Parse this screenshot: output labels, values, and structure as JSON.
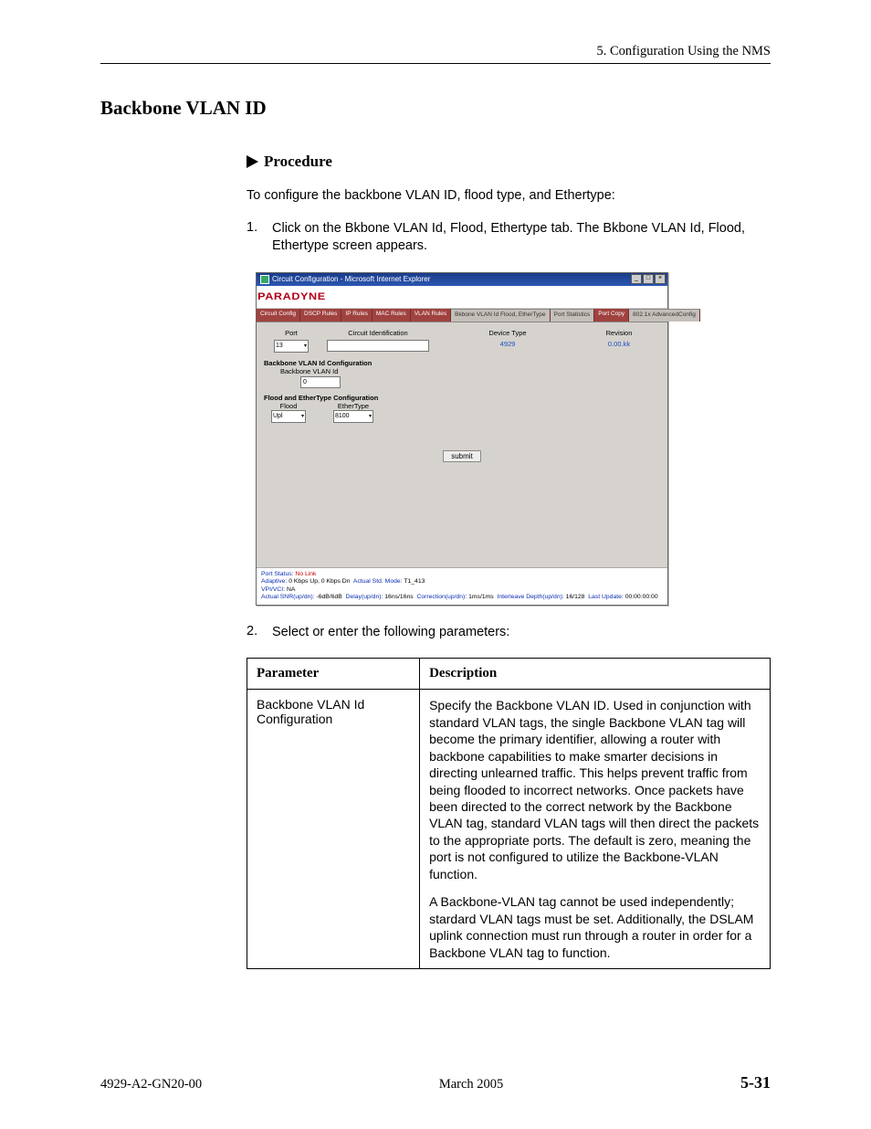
{
  "chapter_header": "5. Configuration Using the NMS",
  "section_title": "Backbone VLAN ID",
  "procedure_label": "Procedure",
  "intro_text": "To configure the backbone VLAN ID, flood type, and Ethertype:",
  "steps": {
    "s1_num": "1.",
    "s1_text": "Click on the Bkbone VLAN Id, Flood, Ethertype tab. The Bkbone VLAN Id, Flood, Ethertype screen appears.",
    "s2_num": "2.",
    "s2_text": "Select or enter the following parameters:"
  },
  "screenshot": {
    "window_title": "Circuit Configuration - Microsoft Internet Explorer",
    "brand": "PARADYNE",
    "tabs": {
      "t0": "Circuit Config",
      "t1": "DSCP Rules",
      "t2": "IP Rules",
      "t3": "MAC Rules",
      "t4": "VLAN Rules",
      "t5": "Bkbone VLAN Id  Flood, EtherType",
      "t6": "Port Statistics",
      "t7": "Port Copy",
      "t8": "802.1x  AdvancedConfig"
    },
    "cols": {
      "port": "Port",
      "circuit_id": "Circuit Identification",
      "device_type": "Device Type",
      "revision": "Revision"
    },
    "vals": {
      "port": "13",
      "device_type": "4929",
      "revision": "0.00.kk"
    },
    "sec1_title": "Backbone VLAN Id Configuration",
    "sec1_label": "Backbone VLAN Id",
    "sec1_value": "0",
    "sec2_title": "Flood and EtherType Configuration",
    "flood_label": "Flood",
    "flood_value": "Upl",
    "ethertype_label": "EtherType",
    "ethertype_value": "8100",
    "submit": "submit",
    "status": {
      "l1a": "Port Status:",
      "l1b": "No Link",
      "l2a": "Adaptive:",
      "l2b": "0 Kbps Up, 0 Kbps Dn",
      "l2c": "Actual Std. Mode:",
      "l2d": "T1_413",
      "l3a": "VPI/VCI:",
      "l3b": "NA",
      "l4a": "Actual SNR(up/dn):",
      "l4b": "-6dB/6dB",
      "l4c": "Delay(up/dn):",
      "l4d": "16ns/16ns",
      "l4e": "Correction(up/dn):",
      "l4f": "1ms/1ms",
      "l4g": "Interleave Depth(up/dn):",
      "l4h": "16/128",
      "l4i": "Last Update:",
      "l4j": "00:00:00:00"
    }
  },
  "table": {
    "h1": "Parameter",
    "h2": "Description",
    "r1_param": "Backbone VLAN Id Configuration",
    "r1_desc_p1": "Specify the Backbone VLAN ID. Used in conjunction with standard VLAN tags, the single Backbone VLAN tag will become the primary identifier, allowing a router with backbone capabilities to make smarter decisions in directing unlearned traffic. This helps prevent traffic from being flooded to incorrect networks. Once packets have been directed to the correct network by the Backbone VLAN tag, standard VLAN tags will then direct the packets to the appropriate ports. The default is zero, meaning the port is not configured to utilize the Backbone-VLAN function.",
    "r1_desc_p2": "A Backbone-VLAN tag cannot be used independently; stardard VLAN tags must be set. Additionally, the DSLAM uplink connection must run through a router in order for a Backbone VLAN tag to function."
  },
  "footer": {
    "doc": "4929-A2-GN20-00",
    "date": "March 2005",
    "page": "5-31"
  }
}
